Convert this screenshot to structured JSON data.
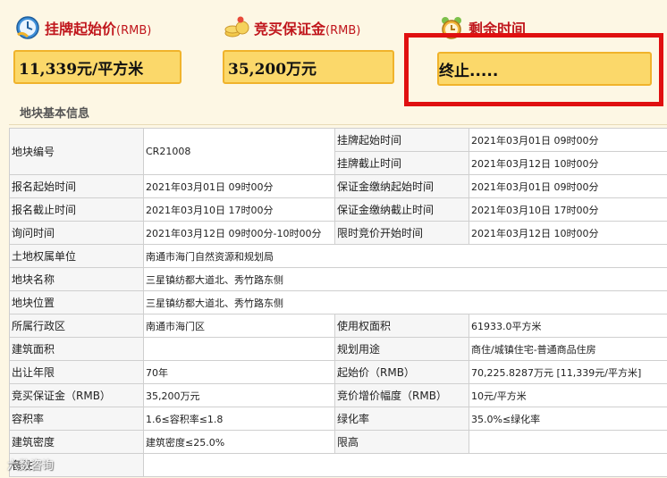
{
  "header": {
    "start_price": {
      "label": "挂牌起始价",
      "unit": "(RMB)",
      "value": "11,339元/平方米",
      "icon": "price-clock-icon"
    },
    "deposit": {
      "label": "竞买保证金",
      "unit": "(RMB)",
      "value": "35,200万元",
      "icon": "coins-icon"
    },
    "remaining": {
      "label": "剩余时间",
      "value": "终止.....",
      "icon": "alarm-clock-icon"
    }
  },
  "section_title": "地块基本信息",
  "rows": {
    "r1": {
      "l1": "地块编号",
      "v1": "CR21008",
      "l2a": "挂牌起始时间",
      "v2a": "2021年03月01日 09时00分",
      "l2b": "挂牌截止时间",
      "v2b": "2021年03月12日 10时00分"
    },
    "r2": {
      "l1": "报名起始时间",
      "v1": "2021年03月01日 09时00分",
      "l2": "保证金缴纳起始时间",
      "v2": "2021年03月01日 09时00分"
    },
    "r3": {
      "l1": "报名截止时间",
      "v1": "2021年03月10日 17时00分",
      "l2": "保证金缴纳截止时间",
      "v2": "2021年03月10日 17时00分"
    },
    "r4": {
      "l1": "询问时间",
      "v1": "2021年03月12日 09时00分-10时00分",
      "l2": "限时竞价开始时间",
      "v2": "2021年03月12日 10时00分"
    },
    "r5": {
      "l1": "土地权属单位",
      "v1": "南通市海门自然资源和规划局"
    },
    "r6": {
      "l1": "地块名称",
      "v1": "三星镇纺都大道北、秀竹路东侧"
    },
    "r7": {
      "l1": "地块位置",
      "v1": "三星镇纺都大道北、秀竹路东侧"
    },
    "r8": {
      "l1": "所属行政区",
      "v1": "南通市海门区",
      "l2": "使用权面积",
      "v2": "61933.0平方米"
    },
    "r9": {
      "l1": "建筑面积",
      "v1": "",
      "l2": "规划用途",
      "v2": "商住/城镇住宅-普通商品住房"
    },
    "r10": {
      "l1": "出让年限",
      "v1": "70年",
      "l2": "起始价（RMB）",
      "v2": "70,225.8287万元 [11,339元/平方米]"
    },
    "r11": {
      "l1": "竞买保证金（RMB）",
      "v1": "35,200万元",
      "l2": "竞价增价幅度（RMB）",
      "v2": "10元/平方米"
    },
    "r12": {
      "l1": "容积率",
      "v1": "1.6≤容积率≤1.8",
      "l2": "绿化率",
      "v2": "35.0%≤绿化率"
    },
    "r13": {
      "l1": "建筑密度",
      "v1": "建筑密度≤25.0%",
      "l2": "限高",
      "v2": ""
    },
    "r14": {
      "l1": "备注",
      "v1": ""
    }
  },
  "watermark": "六数咨询",
  "colors": {
    "label_red": "#c0161c",
    "box_fill": "#fbd86a",
    "box_border": "#f0b32b",
    "highlight_frame": "#e01010",
    "page_bg": "#fdf7e4"
  }
}
